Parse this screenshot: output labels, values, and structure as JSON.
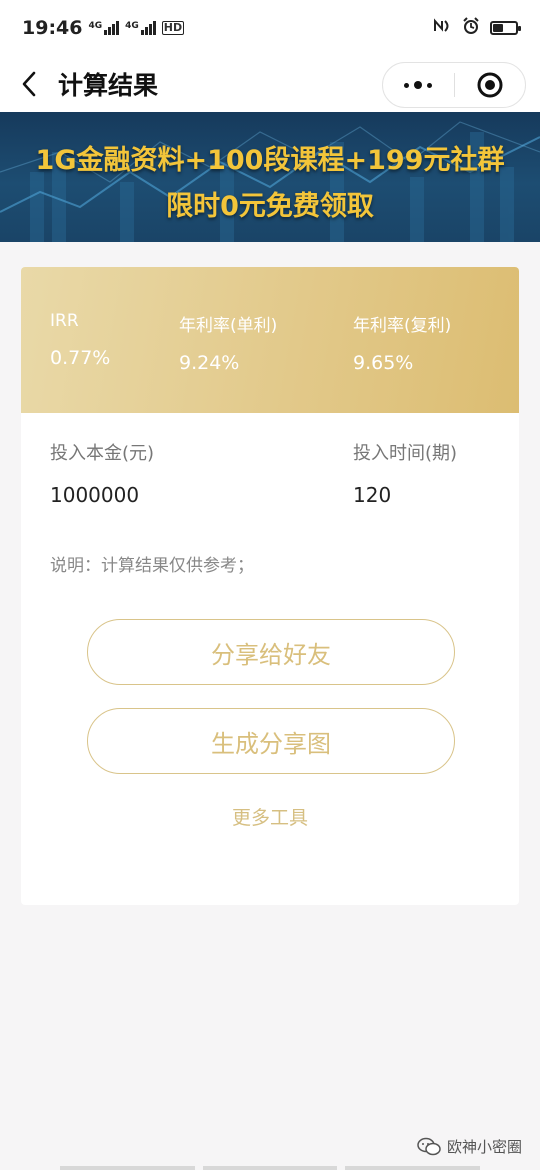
{
  "status_bar": {
    "time": "19:46",
    "network1": "4G",
    "network2": "4G",
    "hd": "HD",
    "battery_level": 0.45
  },
  "nav": {
    "title": "计算结果"
  },
  "banner": {
    "line1": "1G金融资料+100段课程+199元社群",
    "line2": "限时0元免费领取"
  },
  "results": {
    "irr_label": "IRR",
    "irr_value": "0.77%",
    "simple_label": "年利率(单利)",
    "simple_value": "9.24%",
    "compound_label": "年利率(复利)",
    "compound_value": "9.65%"
  },
  "inputs": {
    "principal_label": "投入本金(元)",
    "principal_value": "1000000",
    "periods_label": "投入时间(期)",
    "periods_value": "120"
  },
  "note": "说明：计算结果仅供参考；",
  "buttons": {
    "share": "分享给好友",
    "generate": "生成分享图",
    "more_tools": "更多工具"
  },
  "watermark": "欧神小密圈",
  "colors": {
    "gold_text": "#d9bf7c",
    "banner_text": "#f3c53a",
    "banner_bg": "#1d4d72"
  }
}
